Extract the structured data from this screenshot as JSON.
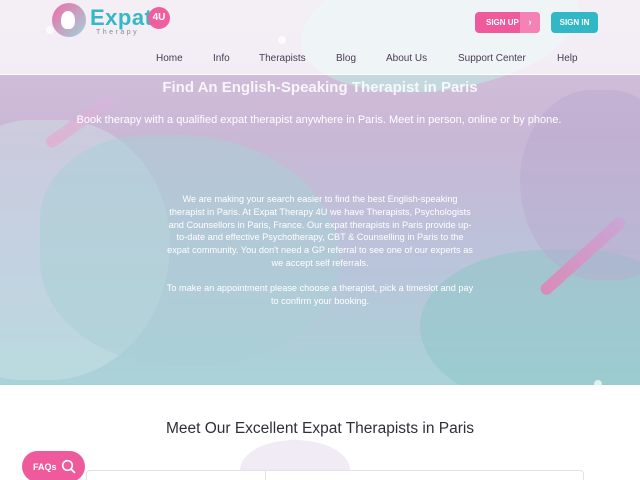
{
  "logo": {
    "name": "Expat",
    "badge": "4U",
    "tagline": "Therapy"
  },
  "auth": {
    "signup_label": "SIGN UP",
    "signup_arrow": "›",
    "signin_label": "SIGN IN"
  },
  "nav": {
    "items": [
      {
        "label": "Home"
      },
      {
        "label": "Info"
      },
      {
        "label": "Therapists"
      },
      {
        "label": "Blog"
      },
      {
        "label": "About Us"
      },
      {
        "label": "Support Center"
      },
      {
        "label": "Help"
      }
    ]
  },
  "hero": {
    "title": "Find An English-Speaking Therapist in Paris",
    "subtitle": "Book therapy with a qualified expat therapist anywhere in Paris. Meet in person, online or by phone.",
    "paragraph1": "We are making your search easier to find the best English-speaking therapist in Paris. At Expat Therapy 4U we have Therapists, Psychologists and Counsellors in Paris, France. Our expat therapists in Paris provide up-to-date and effective Psychotherapy, CBT & Counselling in Paris to the expat community. You don't need a GP referral to see one of our experts as we accept self referrals.",
    "paragraph2": "To make an appointment please choose a therapist, pick a timeslot and pay to confirm your booking."
  },
  "section": {
    "title": "Meet Our Excellent Expat Therapists in Paris"
  },
  "faqs": {
    "label": "FAQs",
    "icon": "search-icon"
  },
  "colors": {
    "pink": "#ef5a9d",
    "teal": "#31b7c6",
    "nav_text": "#4a3b55"
  }
}
